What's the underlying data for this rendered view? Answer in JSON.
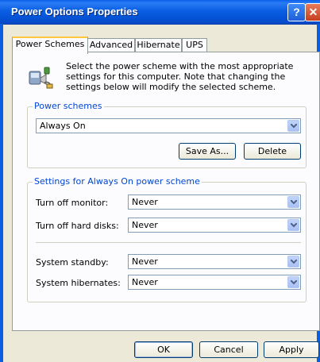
{
  "window": {
    "title": "Power Options Properties",
    "help_glyph": "?",
    "close_glyph": "✕"
  },
  "tabs": [
    {
      "label": "Power Schemes",
      "active": true
    },
    {
      "label": "Advanced",
      "active": false
    },
    {
      "label": "Hibernate",
      "active": false
    },
    {
      "label": "UPS",
      "active": false
    }
  ],
  "intro_text": "Select the power scheme with the most appropriate settings for this computer. Note that changing the settings below will modify the selected scheme.",
  "power_schemes": {
    "group_label": "Power schemes",
    "selected": "Always On",
    "save_as_label": "Save As...",
    "delete_label": "Delete"
  },
  "settings": {
    "group_label": "Settings for Always On power scheme",
    "rows": [
      {
        "label": "Turn off monitor:",
        "value": "Never"
      },
      {
        "label": "Turn off hard disks:",
        "value": "Never"
      },
      {
        "label": "System standby:",
        "value": "Never"
      },
      {
        "label": "System hibernates:",
        "value": "Never"
      }
    ]
  },
  "footer": {
    "ok_label": "OK",
    "cancel_label": "Cancel",
    "apply_label": "Apply"
  },
  "colors": {
    "accent": "#0046d5",
    "titlebar": "#0a5ee2",
    "dialog_bg": "#ece9d8"
  }
}
